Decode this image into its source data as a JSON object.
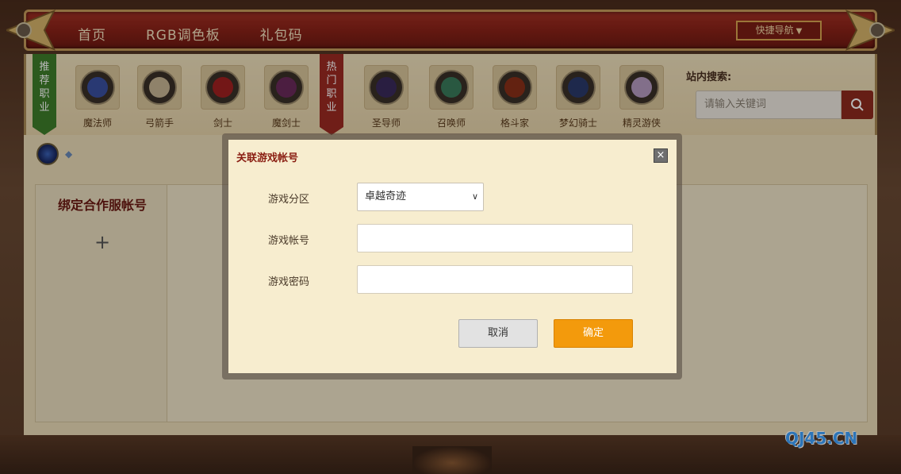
{
  "nav": {
    "items": [
      {
        "label": "首页"
      },
      {
        "label": "RGB调色板"
      },
      {
        "label": "礼包码"
      }
    ],
    "quick_nav": "快捷导航"
  },
  "jobs": {
    "recommended_ribbon": "推荐职业",
    "hot_ribbon": "热门职业",
    "recommended": [
      {
        "label": "魔法师",
        "color": "#3a4fa0"
      },
      {
        "label": "弓箭手",
        "color": "#c7b494"
      },
      {
        "label": "剑士",
        "color": "#a02020"
      },
      {
        "label": "魔剑士",
        "color": "#6a2a5a"
      }
    ],
    "hot": [
      {
        "label": "圣导师",
        "color": "#3a2a5a"
      },
      {
        "label": "召唤师",
        "color": "#3a7a5a"
      },
      {
        "label": "格斗家",
        "color": "#8a3018"
      },
      {
        "label": "梦幻骑士",
        "color": "#2a3a6a"
      },
      {
        "label": "精灵游侠",
        "color": "#b49ac0"
      }
    ]
  },
  "search": {
    "title": "站内搜索:",
    "placeholder": "请输入关键词"
  },
  "panel": {
    "side_title": "绑定合作服帐号",
    "add_symbol": "+"
  },
  "modal": {
    "title": "关联游戏帐号",
    "close_symbol": "×",
    "fields": {
      "zone_label": "游戏分区",
      "zone_value": "卓越奇迹",
      "account_label": "游戏帐号",
      "account_value": "",
      "password_label": "游戏密码",
      "password_value": ""
    },
    "cancel_label": "取消",
    "ok_label": "确定"
  },
  "watermark": "QJ45.CN",
  "colors": {
    "accent_orange": "#f39a0c",
    "nav_red": "#8a2218",
    "title_red": "#8a1e12"
  }
}
